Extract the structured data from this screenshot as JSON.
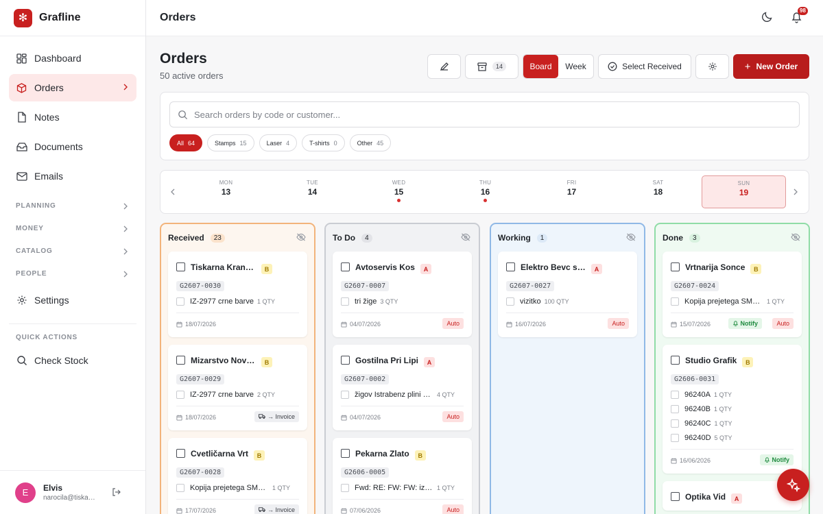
{
  "brand": {
    "name": "Grafline"
  },
  "sidebar": {
    "items": [
      {
        "label": "Dashboard",
        "icon": "dashboard-icon"
      },
      {
        "label": "Orders",
        "icon": "orders-icon",
        "active": true
      },
      {
        "label": "Notes",
        "icon": "notes-icon"
      },
      {
        "label": "Documents",
        "icon": "documents-icon"
      },
      {
        "label": "Emails",
        "icon": "emails-icon"
      }
    ],
    "sections": [
      "PLANNING",
      "MONEY",
      "CATALOG",
      "PEOPLE"
    ],
    "settings_label": "Settings",
    "quick_actions_label": "QUICK ACTIONS",
    "check_stock_label": "Check Stock"
  },
  "user": {
    "initial": "E",
    "name": "Elvis",
    "email": "narocila@tiskarna.si"
  },
  "topbar": {
    "title": "Orders",
    "notification_count": "98"
  },
  "page": {
    "title": "Orders",
    "subtitle": "50 active orders"
  },
  "toolbar": {
    "archive_count": "14",
    "view_board": "Board",
    "view_week": "Week",
    "select_received": "Select Received",
    "new_order": "New Order"
  },
  "search": {
    "placeholder": "Search orders by code or customer..."
  },
  "filters": [
    {
      "label": "All",
      "count": "64"
    },
    {
      "label": "Stamps",
      "count": "15"
    },
    {
      "label": "Laser",
      "count": "4"
    },
    {
      "label": "T-shirts",
      "count": "0"
    },
    {
      "label": "Other",
      "count": "45"
    }
  ],
  "week": [
    {
      "dow": "MON",
      "num": "13"
    },
    {
      "dow": "TUE",
      "num": "14"
    },
    {
      "dow": "WED",
      "num": "15"
    },
    {
      "dow": "THU",
      "num": "16"
    },
    {
      "dow": "FRI",
      "num": "17"
    },
    {
      "dow": "SAT",
      "num": "18"
    },
    {
      "dow": "SUN",
      "num": "19"
    }
  ],
  "columns": [
    {
      "title": "Received",
      "count": "23",
      "cards": [
        {
          "customer": "Tiskarna Kranj ...",
          "priority": "B",
          "code": "G2607-0030",
          "lines": [
            {
              "name": "IZ-2977 crne barve",
              "qty": "1 QTY"
            }
          ],
          "date": "18/07/2026",
          "tags": []
        },
        {
          "customer": "Mizarstvo Nova...",
          "priority": "B",
          "code": "G2607-0029",
          "lines": [
            {
              "name": "IZ-2977 crne barve",
              "qty": "2 QTY"
            }
          ],
          "date": "18/07/2026",
          "tags": [
            "→ Invoice"
          ]
        },
        {
          "customer": "Cvetličarna Vrt",
          "priority": "B",
          "code": "G2607-0028",
          "lines": [
            {
              "name": "Kopija prejetega SMS-...",
              "qty": "1 QTY"
            }
          ],
          "date": "17/07/2026",
          "tags": [
            "→ Invoice"
          ]
        }
      ]
    },
    {
      "title": "To Do",
      "count": "4",
      "cards": [
        {
          "customer": "Avtoservis Kos",
          "priority": "A",
          "code": "G2607-0007",
          "lines": [
            {
              "name": "tri žige",
              "qty": "3 QTY"
            }
          ],
          "date": "04/07/2026",
          "tags": [
            "Auto"
          ]
        },
        {
          "customer": "Gostilna Pri Lipi",
          "priority": "A",
          "code": "G2607-0002",
          "lines": [
            {
              "name": "žigov Istrabenz plini s ...",
              "qty": "4 QTY"
            }
          ],
          "date": "04/07/2026",
          "tags": [
            "Auto"
          ]
        },
        {
          "customer": "Pekarna Zlato",
          "priority": "B",
          "code": "G2606-0005",
          "lines": [
            {
              "name": "Fwd: RE: FW: FW: izdel...",
              "qty": "1 QTY"
            }
          ],
          "date": "07/06/2026",
          "tags": [
            "Auto"
          ]
        }
      ]
    },
    {
      "title": "Working",
      "count": "1",
      "cards": [
        {
          "customer": "Elektro Bevc s.p.",
          "priority": "A",
          "code": "G2607-0027",
          "lines": [
            {
              "name": "vizitko",
              "qty": "100 QTY"
            }
          ],
          "date": "16/07/2026",
          "tags": [
            "Auto"
          ]
        }
      ]
    },
    {
      "title": "Done",
      "count": "3",
      "cards": [
        {
          "customer": "Vrtnarija Sonce",
          "priority": "B",
          "code": "G2607-0024",
          "lines": [
            {
              "name": "Kopija prejetega SMS-...",
              "qty": "1 QTY"
            }
          ],
          "date": "15/07/2026",
          "tags": [
            "Notify",
            "Auto"
          ]
        },
        {
          "customer": "Studio Grafik",
          "priority": "B",
          "code": "G2606-0031",
          "lines": [
            {
              "name": "96240A",
              "qty": "1 QTY"
            },
            {
              "name": "96240B",
              "qty": "1 QTY"
            },
            {
              "name": "96240C",
              "qty": "1 QTY"
            },
            {
              "name": "96240D",
              "qty": "5 QTY"
            }
          ],
          "date": "16/06/2026",
          "tags": [
            "Notify"
          ]
        },
        {
          "customer": "Optika Vid",
          "priority": "A",
          "code": "",
          "lines": [],
          "date": "",
          "tags": []
        }
      ]
    }
  ],
  "colors": {
    "accent": "#c8201f",
    "received": "#f2b37a",
    "todo": "#c9ccd2",
    "working": "#8fb8e6",
    "done": "#8fdca6"
  }
}
